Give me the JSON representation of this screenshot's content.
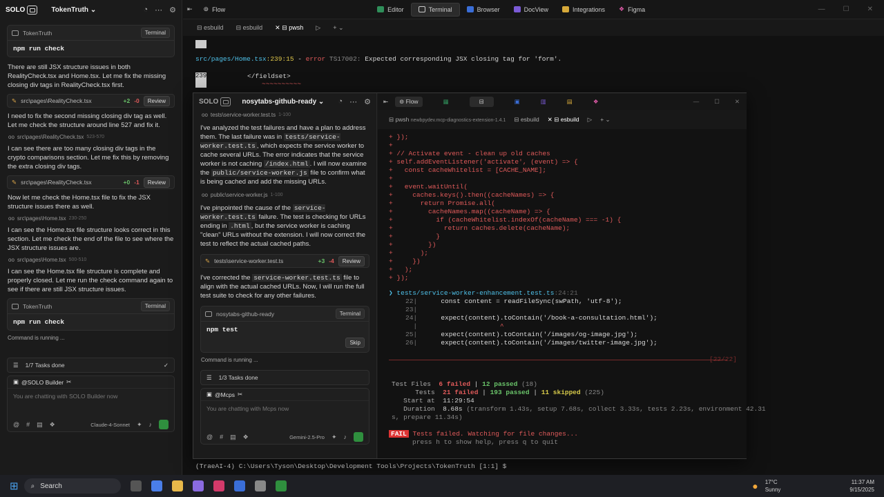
{
  "left": {
    "logo": "SOLO",
    "project": "TokenTruth",
    "card1": {
      "title": "TokenTruth",
      "tag": "Terminal",
      "cmd": "npm run check"
    },
    "msg1": "There are still JSX structure issues in both RealityCheck.tsx and Home.tsx. Let me fix the missing closing div tags in RealityCheck.tsx first.",
    "diff1": {
      "file": "src\\pages\\RealityCheck.tsx",
      "plus": "+2",
      "minus": "-0",
      "btn": "Review"
    },
    "msg2": "I need to fix the second missing closing div tag as well. Let me check the structure around line 527 and fix it.",
    "ref1": {
      "file": "src\\pages\\RealityCheck.tsx",
      "range": "523-570"
    },
    "msg3": "I can see there are too many closing div tags in the crypto comparisons section. Let me fix this by removing the extra closing div tags.",
    "diff2": {
      "file": "src\\pages\\RealityCheck.tsx",
      "plus": "+0",
      "minus": "-1",
      "btn": "Review"
    },
    "msg4": "Now let me check the Home.tsx file to fix the JSX structure issues there as well.",
    "ref2": {
      "file": "src\\pages\\Home.tsx",
      "range": "230-250"
    },
    "msg5": "I can see the Home.tsx file structure looks correct in this section. Let me check the end of the file to see where the JSX structure issues are.",
    "ref3": {
      "file": "src\\pages\\Home.tsx",
      "range": "500-510"
    },
    "msg6": "I can see the Home.tsx file structure is complete and properly closed. Let me run the check command again to see if there are still JSX structure issues.",
    "card2": {
      "title": "TokenTruth",
      "tag": "Terminal",
      "cmd": "npm run check"
    },
    "running": "Command is running ...",
    "tasks": "1/7 Tasks done",
    "chat": {
      "agent": "@SOLO Builder",
      "placeholder": "You are chatting with SOLO Builder now",
      "model": "Claude-4-Sonnet"
    }
  },
  "topbar": {
    "flow": "Flow",
    "tabs": [
      "Editor",
      "Terminal",
      "Browser",
      "DocView",
      "Integrations",
      "Figma"
    ]
  },
  "termtabs": [
    "esbuild",
    "esbuild",
    "pwsh"
  ],
  "term": {
    "err_file": "src/pages/Home.tsx",
    "err_pos": ":239:15",
    "err_sep": " - ",
    "err_word": "error",
    "err_code": "TS17002:",
    "err_msg": "Expected corresponding JSX closing tag for 'form'.",
    "ln": "239",
    "src": "          </fieldset>",
    "squig": "~~~~~~~~~~",
    "prompt": "(TraeAI-4) C:\\Users\\Tyson\\Desktop\\Development Tools\\Projects\\TokenTruth [1:1] $"
  },
  "win": {
    "logo": "SOLO",
    "project": "nosytabs-github-ready",
    "ref1": {
      "file": "tests\\service-worker.test.ts",
      "range": "1-100"
    },
    "msg1a": "I've analyzed the test failures and have a plan to address them. The last failure was in",
    "code1": "tests/service-worker.test.ts",
    "msg1b": ", which expects the service worker to cache several URLs. The error indicates that the service worker is not caching",
    "code2": "/index.html",
    "msg1c": ". I will now examine the",
    "code3": "public/service-worker.js",
    "msg1d": "file to confirm what is being cached and add the missing URLs.",
    "ref2": {
      "file": "public\\service-worker.js",
      "range": "1-100"
    },
    "msg2a": "I've pinpointed the cause of the",
    "code4": "service-worker.test.ts",
    "msg2b": "failure. The test is checking for URLs ending in",
    "code5": ".html",
    "msg2c": ", but the service worker is caching \"clean\" URLs without the extension. I will now correct the test to reflect the actual cached paths.",
    "diff": {
      "file": "tests\\service-worker.test.ts",
      "plus": "+3",
      "minus": "-4",
      "btn": "Review"
    },
    "msg3a": "I've corrected the",
    "code6": "service-worker.test.ts",
    "msg3b": "file to align with the actual cached URLs. Now, I will run the full test suite to check for any other failures.",
    "card": {
      "title": "nosytabs-github-ready",
      "tag": "Terminal",
      "cmd": "npm test",
      "btn": "Skip"
    },
    "running": "Command is running ...",
    "tasks": "1/3 Tasks done",
    "chat": {
      "agent": "@Mcps",
      "placeholder": "You are chatting with Mcps now",
      "model": "Gemini-2.5-Pro"
    },
    "flow": "Flow",
    "tabs": {
      "pwsh": "pwsh",
      "pwsh_sub": "newbpydev.mcp-diagnostics-extension-1.4.1",
      "t2": "esbuild",
      "t3": "esbuild"
    },
    "code": [
      "+ });",
      "+",
      "+ // Activate event - clean up old caches",
      "+ self.addEventListener('activate', (event) => {",
      "+   const cacheWhitelist = [CACHE_NAME];",
      "+",
      "+   event.waitUntil(",
      "+     caches.keys().then((cacheNames) => {",
      "+       return Promise.all(",
      "+         cacheNames.map((cacheName) => {",
      "+           if (cacheWhitelist.indexOf(cacheName) === -1) {",
      "+             return caches.delete(cacheName);",
      "+           }",
      "+         })",
      "+       );",
      "+     })",
      "+   );",
      "+ });"
    ],
    "testfile": "tests/service-worker-enhancement.test.ts",
    "testpos": ":24:21",
    "src": [
      {
        "n": "22|",
        "t": "      const content = readFileSync(swPath, 'utf-8');"
      },
      {
        "n": "23|",
        "t": ""
      },
      {
        "n": "24|",
        "t": "      expect(content).toContain('/book-a-consultation.html');"
      },
      {
        "n": "  |",
        "t": "                     ^"
      },
      {
        "n": "25|",
        "t": "      expect(content).toContain('/images/og-image.jpg');"
      },
      {
        "n": "26|",
        "t": "      expect(content).toContain('/images/twitter-image.jpg');"
      }
    ],
    "sep": "[22/22]",
    "summary": {
      "files_label": "Test Files",
      "files_failed": "6 failed",
      "files_passed": "12 passed",
      "files_total": "(18)",
      "tests_label": "Tests",
      "tests_failed": "21 failed",
      "tests_passed": "193 passed",
      "tests_skipped": "11 skipped",
      "tests_total": "(225)",
      "start_label": "Start at",
      "start": "11:29:54",
      "dur_label": "Duration",
      "dur": "8.68s",
      "dur_detail": "(transform 1.43s, setup 7.68s, collect 3.33s, tests 2.23s, environment 42.31",
      "dur_detail2": "s, prepare 11.34s)"
    },
    "fail_badge": "FAIL",
    "fail_msg": "Tests failed. Watching for file changes...",
    "help": "press h to show help, press q to quit"
  },
  "taskbar": {
    "search": "Search",
    "temp": "17°C",
    "weather": "Sunny",
    "time": "11:37 AM",
    "date": "9/15/2025"
  }
}
